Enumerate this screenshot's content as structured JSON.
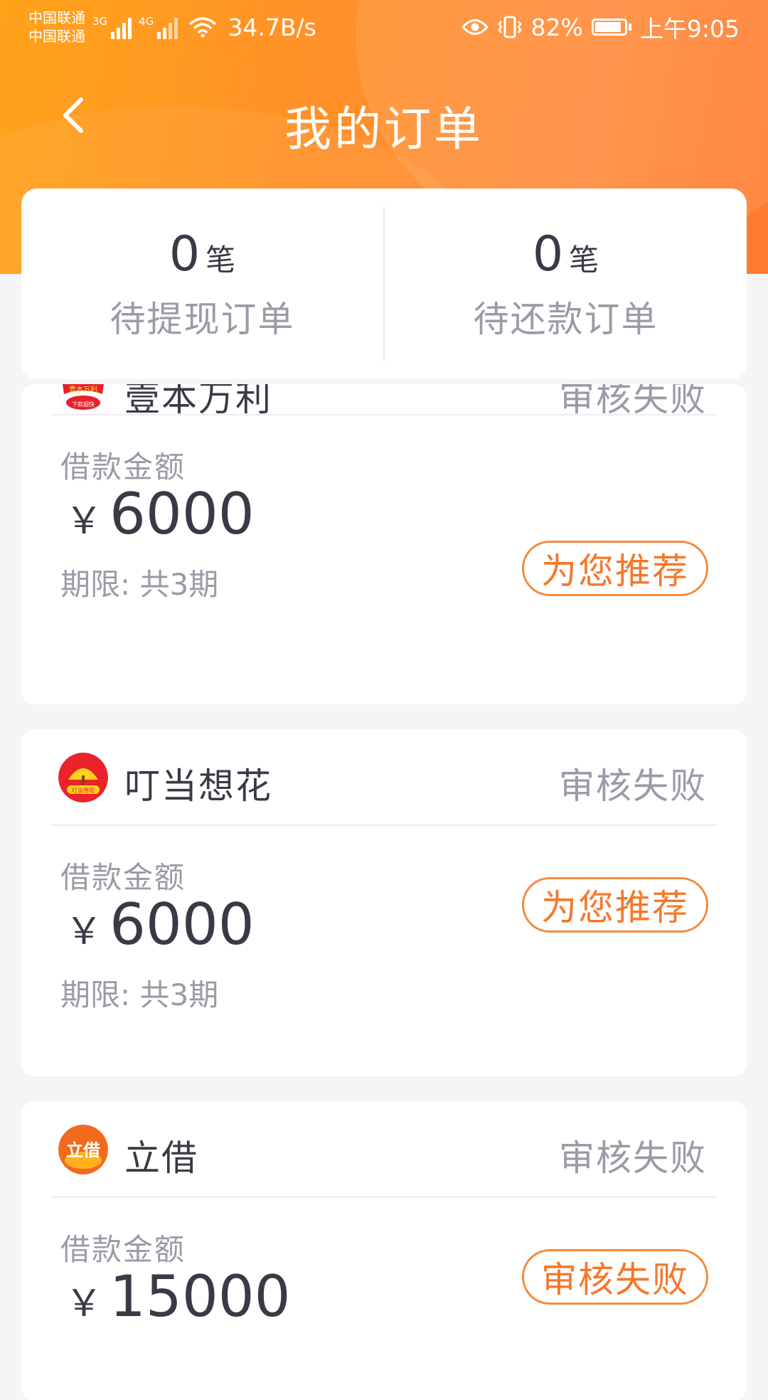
{
  "status_bar": {
    "carrier_1": "中国联通",
    "carrier_2": "中国联通",
    "network_1": "3G",
    "network_2": "4G",
    "net_speed": "34.7B/s",
    "battery": "82%",
    "time": "上午9:05",
    "icons": [
      "signal-icon",
      "wifi-icon",
      "eye-icon",
      "vibrate-icon",
      "battery-charging-icon"
    ]
  },
  "nav": {
    "title": "我的订单",
    "back_icon": "chevron-left-icon"
  },
  "summary": {
    "withdraw": {
      "count": "0",
      "unit": "笔",
      "label": "待提现订单"
    },
    "repay": {
      "count": "0",
      "unit": "笔",
      "label": "待还款订单"
    }
  },
  "orders": [
    {
      "lender": "壹本万利",
      "status": "审核失败",
      "amount_label": "借款金额",
      "currency": "￥",
      "amount": "6000",
      "term": "期限: 共3期",
      "action": "为您推荐",
      "logo_text": "壹本万利",
      "logo_sub": "下款超快"
    },
    {
      "lender": "叮当想花",
      "status": "审核失败",
      "amount_label": "借款金额",
      "currency": "￥",
      "amount": "6000",
      "term": "期限: 共3期",
      "action": "为您推荐",
      "logo_text": "叮当想花"
    },
    {
      "lender": "立借",
      "status": "审核失败",
      "amount_label": "借款金额",
      "currency": "￥",
      "amount": "15000",
      "action": "审核失败",
      "logo_text": "立借"
    }
  ],
  "colors": {
    "header_start": "#ffa31a",
    "header_end": "#ff7a2e",
    "accent": "#f5782a",
    "muted_text": "#9b9ba6",
    "dark_text": "#3a3a46"
  }
}
